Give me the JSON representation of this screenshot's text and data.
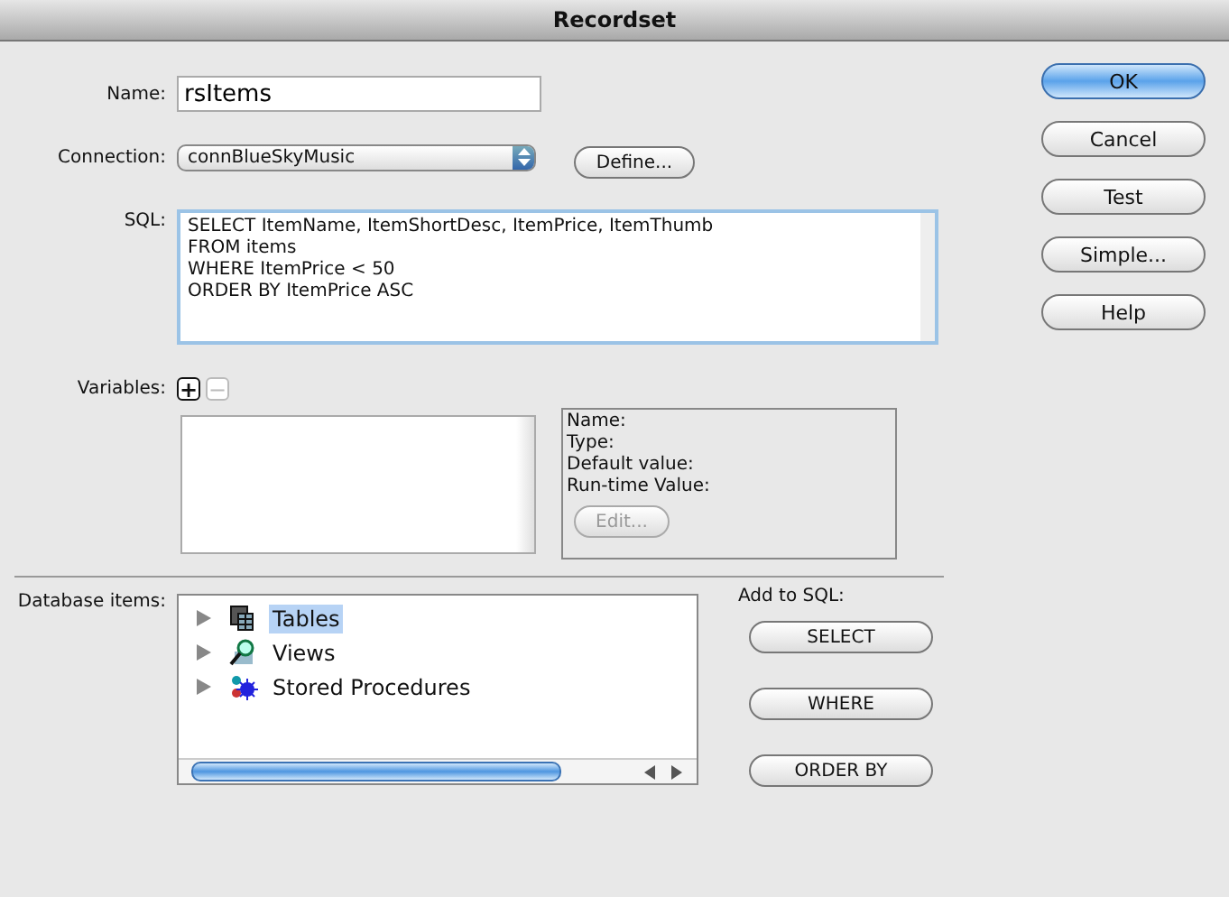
{
  "window": {
    "title": "Recordset"
  },
  "name_field": {
    "label": "Name:",
    "value": "rsItems"
  },
  "connection": {
    "label": "Connection:",
    "value": "connBlueSkyMusic",
    "define_button": "Define..."
  },
  "sql": {
    "label": "SQL:",
    "lines": [
      "SELECT ItemName, ItemShortDesc, ItemPrice, ItemThumb",
      "FROM items",
      "WHERE ItemPrice < 50",
      "ORDER BY ItemPrice ASC"
    ]
  },
  "variables": {
    "label": "Variables:",
    "add_button": {
      "label": "+",
      "disabled": false
    },
    "remove_button": {
      "label": "−",
      "disabled": true
    },
    "details": [
      "Name:",
      "Type:",
      "Default value:",
      "Run-time Value:"
    ],
    "edit_button": {
      "label": "Edit...",
      "disabled": true
    }
  },
  "database_items": {
    "label": "Database items:",
    "items": [
      {
        "label": "Tables",
        "kind": "tables",
        "expanded": false,
        "selected": true
      },
      {
        "label": "Views",
        "kind": "views",
        "expanded": false,
        "selected": false
      },
      {
        "label": "Stored Procedures",
        "kind": "procedures",
        "expanded": false,
        "selected": false
      }
    ]
  },
  "add_to_sql": {
    "label": "Add to SQL:",
    "buttons": [
      "SELECT",
      "WHERE",
      "ORDER BY"
    ]
  },
  "buttons": [
    {
      "label": "OK",
      "default": true
    },
    {
      "label": "Cancel",
      "default": false
    },
    {
      "label": "Test",
      "default": false
    },
    {
      "label": "Simple...",
      "default": false
    },
    {
      "label": "Help",
      "default": false
    }
  ]
}
